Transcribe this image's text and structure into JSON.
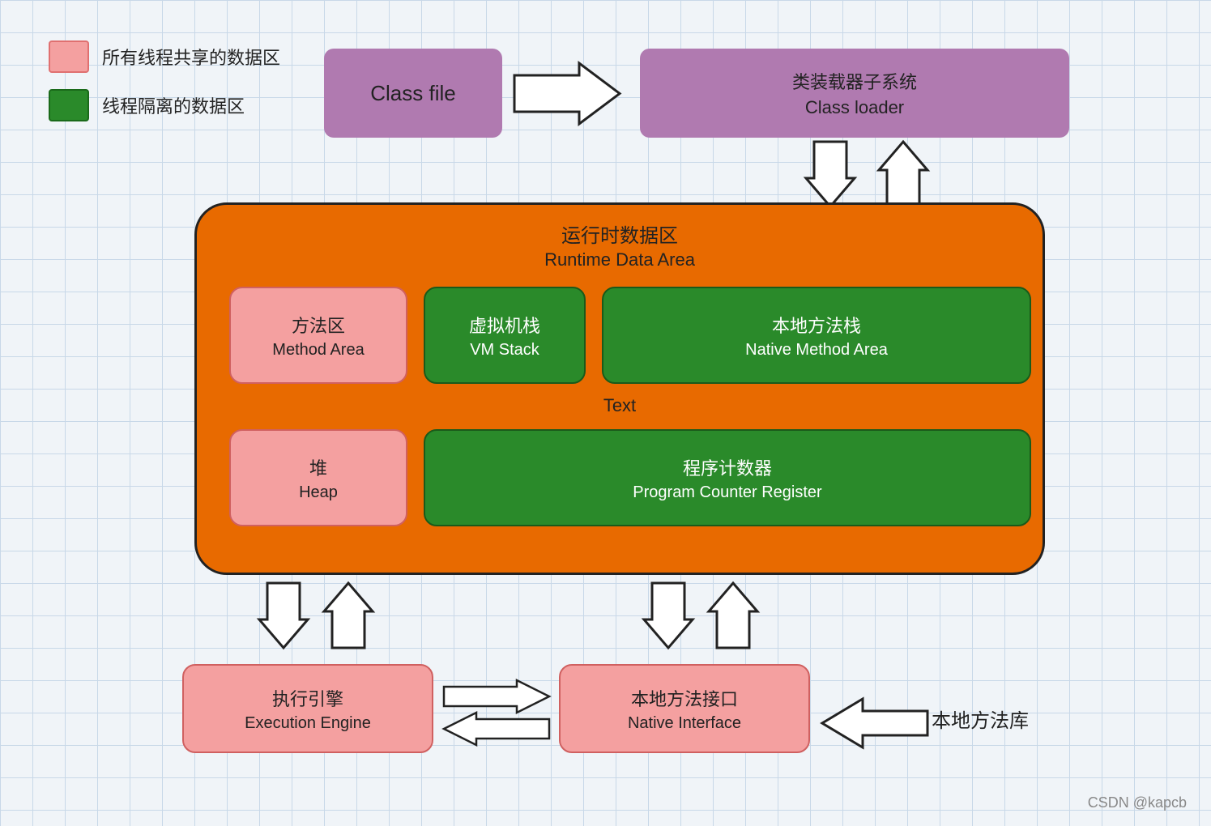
{
  "legend": {
    "shared_label": "所有线程共享的数据区",
    "isolated_label": "线程隔离的数据区"
  },
  "class_file": {
    "text": "Class file"
  },
  "class_loader": {
    "zh": "类装载器子系统",
    "en": "Class loader"
  },
  "runtime_area": {
    "zh": "运行时数据区",
    "en": "Runtime Data Area"
  },
  "method_area": {
    "zh": "方法区",
    "en": "Method Area"
  },
  "vm_stack": {
    "zh": "虚拟机栈",
    "en": "VM Stack"
  },
  "native_method_area": {
    "zh": "本地方法栈",
    "en": "Native Method Area"
  },
  "text_label": {
    "text": "Text"
  },
  "heap": {
    "zh": "堆",
    "en": "Heap"
  },
  "program_counter": {
    "zh": "程序计数器",
    "en": "Program Counter Register"
  },
  "execution_engine": {
    "zh": "执行引擎",
    "en": "Execution Engine"
  },
  "native_interface": {
    "zh": "本地方法接口",
    "en": "Native Interface"
  },
  "native_lib": {
    "text": "本地方法库"
  },
  "watermark": {
    "text": "CSDN @kapcb"
  }
}
